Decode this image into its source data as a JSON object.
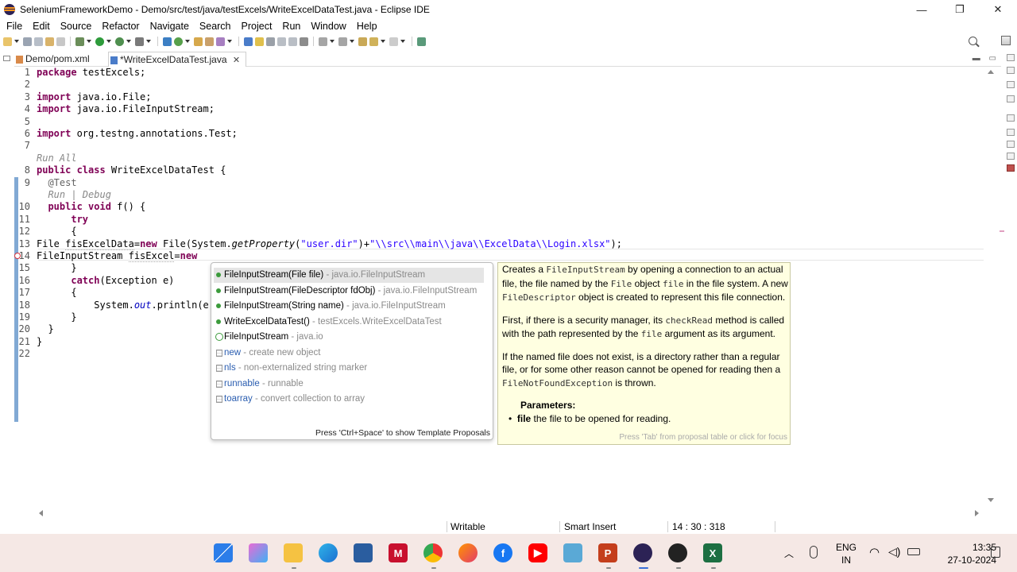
{
  "window": {
    "title": "SeleniumFrameworkDemo - Demo/src/test/java/testExcels/WriteExcelDataTest.java - Eclipse IDE",
    "minimize": "—",
    "restore": "❐",
    "close": "✕"
  },
  "menu": [
    "File",
    "Edit",
    "Source",
    "Refactor",
    "Navigate",
    "Search",
    "Project",
    "Run",
    "Window",
    "Help"
  ],
  "tabs": [
    {
      "label": "Demo/pom.xml",
      "active": false
    },
    {
      "label": "*WriteExcelDataTest.java",
      "active": true
    }
  ],
  "tab_close": "✕",
  "code": {
    "l1": {
      "n": "1",
      "kw": "package",
      "rest": " testExcels;"
    },
    "l2": {
      "n": "2"
    },
    "l3": {
      "n": "3",
      "kw": "import",
      "rest": " java.io.File;"
    },
    "l4": {
      "n": "4",
      "kw": "import",
      "rest": " java.io.FileInputStream;"
    },
    "l5": {
      "n": "5"
    },
    "l6": {
      "n": "6",
      "kw": "import",
      "rest": " org.testng.annotations.Test;"
    },
    "l7": {
      "n": "7"
    },
    "lens1": "Run All",
    "l8": {
      "n": "8",
      "kw": "public class",
      "rest": " WriteExcelDataTest {"
    },
    "l9": {
      "n": "9",
      "ann": "@Test"
    },
    "lens2": "Run | Debug",
    "l10": {
      "n": "10",
      "kw": "public void",
      "rest": " f() {"
    },
    "l11": {
      "n": "11",
      "kw": "try"
    },
    "l12": {
      "n": "12",
      "rest": "{"
    },
    "l13": {
      "n": "13",
      "a": "File ",
      "var": "fisExcelData",
      "b": "=",
      "kw": "new",
      "c": " File(System.",
      "it": "getProperty",
      "d": "(",
      "str1": "\"user.dir\"",
      "e": ")+",
      "str2": "\"\\\\src\\\\main\\\\java\\\\ExcelData\\\\Login.xlsx\"",
      "f": ");"
    },
    "l14": {
      "n": "14",
      "a": "FileInputStream ",
      "var": "fisExcel",
      "b": "=",
      "kw": "new"
    },
    "l15": {
      "n": "15",
      "rest": "}"
    },
    "l16": {
      "n": "16",
      "kw": "catch",
      "rest": "(Exception e)"
    },
    "l17": {
      "n": "17",
      "rest": "{"
    },
    "l18": {
      "n": "18",
      "a": "System.",
      "fld": "out",
      "b": ".println(e"
    },
    "l19": {
      "n": "19",
      "rest": "}"
    },
    "l20": {
      "n": "20",
      "rest": "}"
    },
    "l21": {
      "n": "21",
      "rest": "}"
    },
    "l22": {
      "n": "22"
    }
  },
  "assist": {
    "proposals": [
      {
        "icon": "constructor",
        "name": "FileInputStream(File file)",
        "qual": " - java.io.FileInputStream"
      },
      {
        "icon": "constructor",
        "name": "FileInputStream(FileDescriptor fdObj)",
        "qual": " - java.io.FileInputStream"
      },
      {
        "icon": "constructor",
        "name": "FileInputStream(String name)",
        "qual": " - java.io.FileInputStream"
      },
      {
        "icon": "constructor",
        "name": "WriteExcelDataTest()",
        "qual": " - testExcels.WriteExcelDataTest"
      },
      {
        "icon": "class",
        "name": "FileInputStream",
        "qual": " - java.io"
      },
      {
        "icon": "template",
        "name": "new",
        "qual": " - create new object"
      },
      {
        "icon": "template",
        "name": "nls",
        "qual": " - non-externalized string marker"
      },
      {
        "icon": "template",
        "name": "runnable",
        "qual": " - runnable"
      },
      {
        "icon": "template",
        "name": "toarray",
        "qual": " - convert collection to array"
      }
    ],
    "footer": "Press 'Ctrl+Space' to show Template Proposals"
  },
  "doc": {
    "p1": {
      "a": "Creates a ",
      "c1": "FileInputStream",
      "b": " by opening a connection to an actual file, the file named by the ",
      "c2": "File",
      "c": " object ",
      "c3": "file",
      "d": " in the file system. A new ",
      "c4": "FileDescriptor",
      "e": " object is created to represent this file connection."
    },
    "p2": {
      "a": "First, if there is a security manager, its ",
      "c1": "checkRead",
      "b": " method is called with the path represented by the ",
      "c2": "file",
      "c": " argument as its argument."
    },
    "p3": {
      "a": "If the named file does not exist, is a directory rather than a regular file, or for some other reason cannot be opened for reading then a ",
      "c1": "FileNotFoundException",
      "b": " is thrown."
    },
    "params_heading": "Parameters:",
    "param_name": "file",
    "param_desc": " the file to be opened for reading.",
    "hint": "Press 'Tab' from proposal table or click for focus"
  },
  "status": {
    "writable": "Writable",
    "insert": "Smart Insert",
    "position": "14 : 30 : 318"
  },
  "taskbar": {
    "lang1": "ENG",
    "lang2": "IN",
    "time": "13:35",
    "date": "27-10-2024"
  },
  "colors": {
    "keyword": "#7f0055",
    "string": "#2a00ff",
    "field": "#0000c0",
    "doc_bg": "#ffffe1",
    "taskbar_bg": "#f5e8e5"
  }
}
